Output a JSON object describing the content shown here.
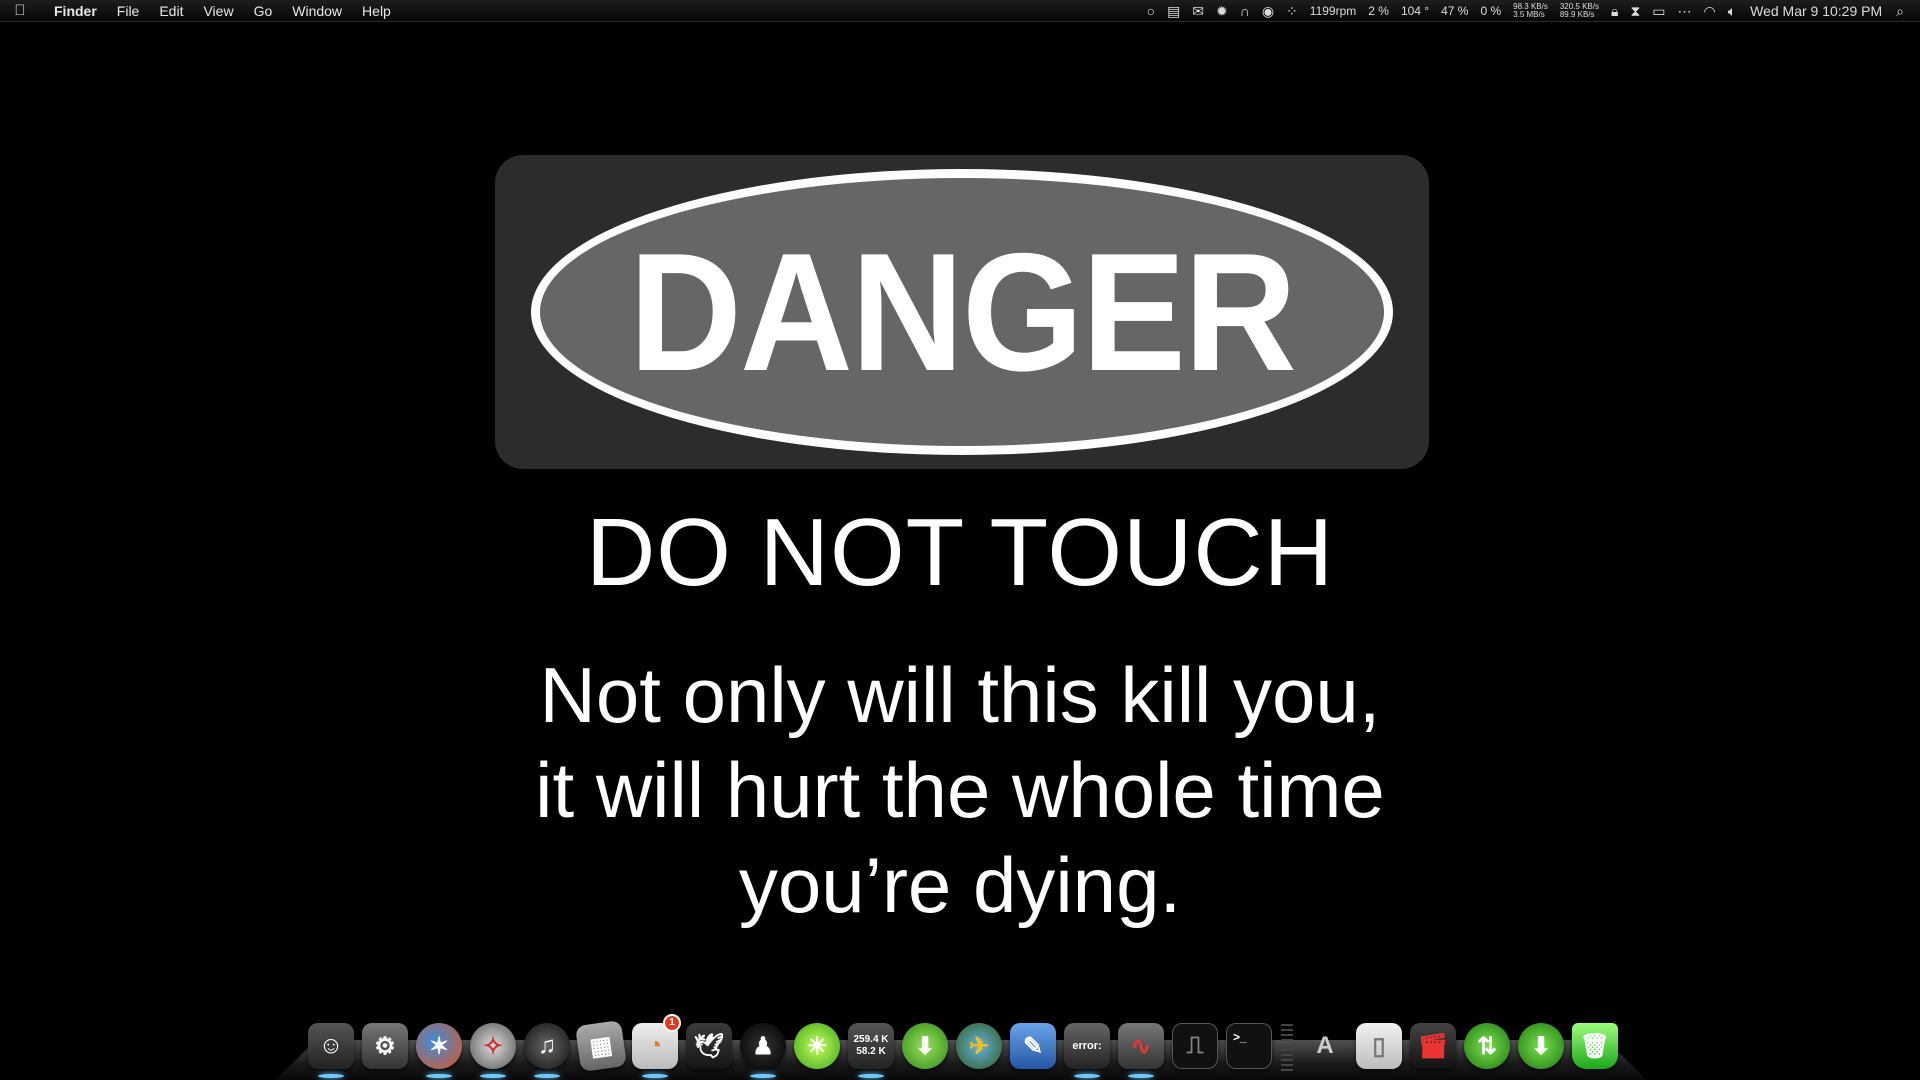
{
  "menubar": {
    "apple_icon": "apple-icon",
    "app_name": "Finder",
    "menus": [
      "File",
      "Edit",
      "View",
      "Go",
      "Window",
      "Help"
    ],
    "status": {
      "fan": "1199rpm",
      "cpu": "2 %",
      "temp": "104 °",
      "mem": "47 %",
      "disk": "0 %",
      "net_up_1": "98.3 KB/s",
      "net_down_1": "3.5 MB/s",
      "net_up_2": "320.5 KB/s",
      "net_down_2": "89.9 KB/s"
    },
    "clock": "Wed Mar 9  10:29 PM"
  },
  "wallpaper": {
    "danger": "DANGER",
    "subtitle": "DO NOT TOUCH",
    "line1": "Not only will this kill you,",
    "line2": "it will hurt the whole time",
    "line3": "you’re dying.",
    "colors": {
      "panel": "#2c2c2c",
      "oval_fill": "#666666",
      "oval_border": "#fdfdfd"
    }
  },
  "dock": {
    "netmeter_top": "259.4 K",
    "netmeter_bottom": "58.2 K",
    "news_badge": "1",
    "terminal_prompt": ">_",
    "error_label": "error:"
  }
}
